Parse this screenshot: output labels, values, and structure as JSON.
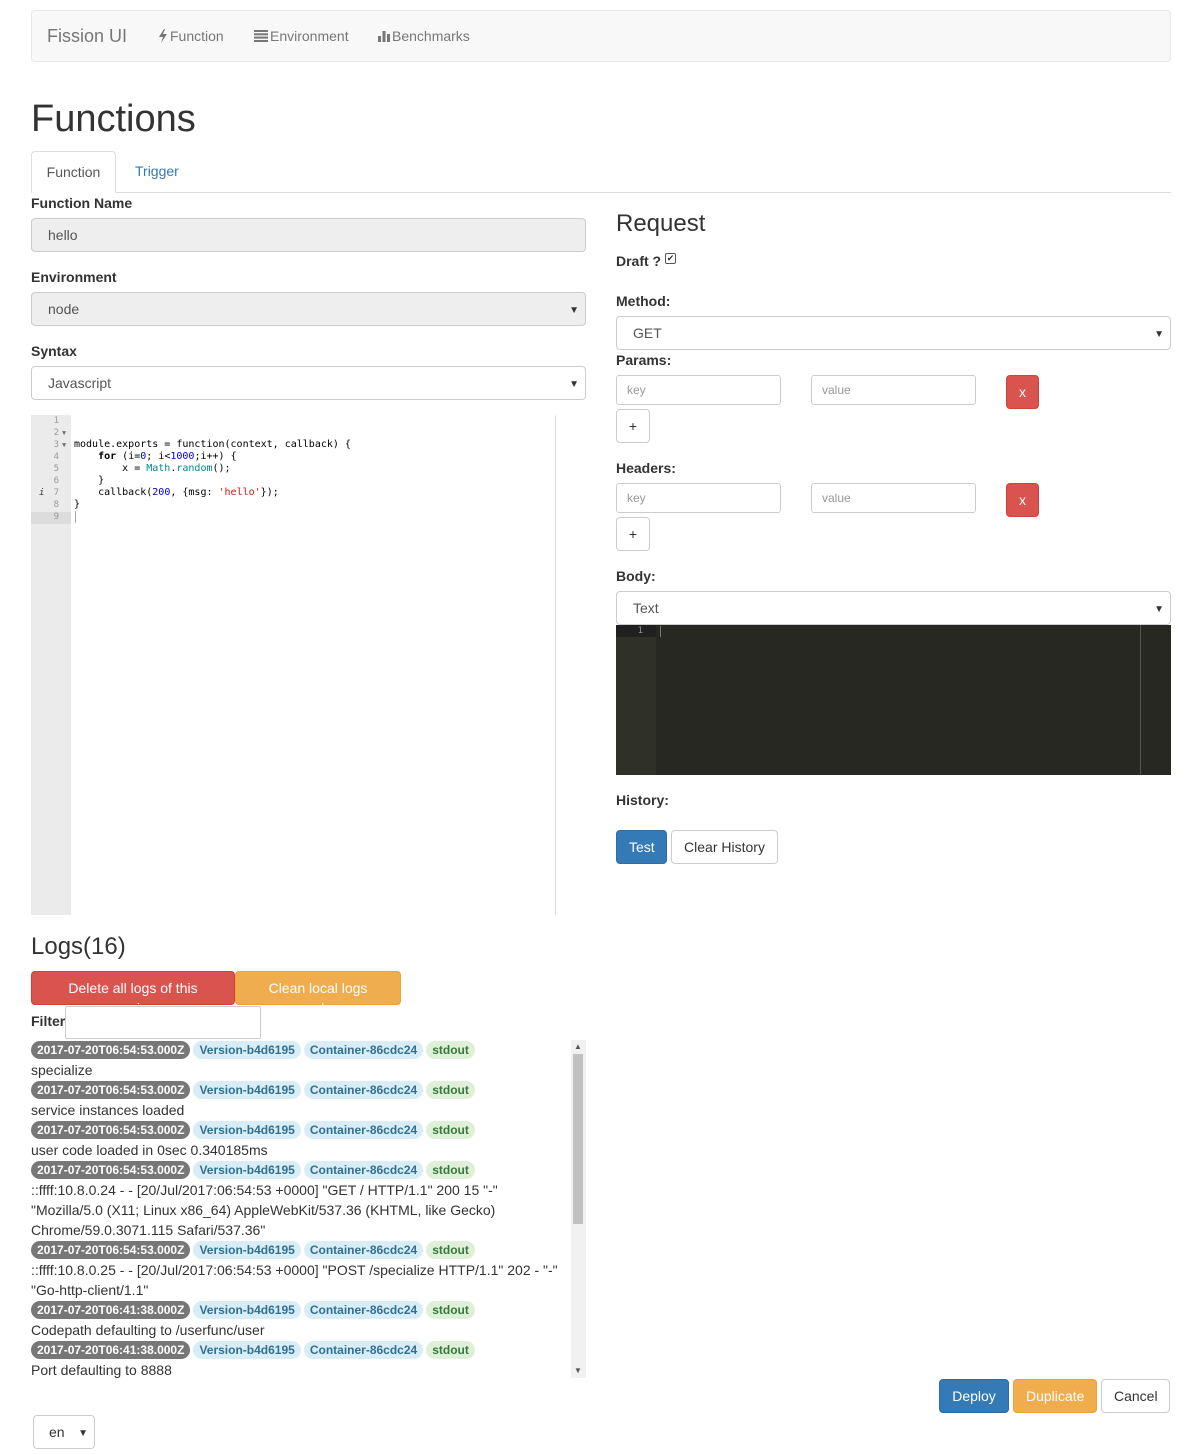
{
  "nav": {
    "brand": "Fission UI",
    "items": [
      {
        "label": "Function",
        "icon": "flash-icon"
      },
      {
        "label": "Environment",
        "icon": "list-icon"
      },
      {
        "label": "Benchmarks",
        "icon": "bar-chart-icon"
      }
    ]
  },
  "page_title": "Functions",
  "tabs": [
    {
      "label": "Function",
      "active": true
    },
    {
      "label": "Trigger",
      "active": false
    }
  ],
  "form": {
    "name_label": "Function Name",
    "name_value": "hello",
    "env_label": "Environment",
    "env_value": "node",
    "syntax_label": "Syntax",
    "syntax_value": "Javascript"
  },
  "code": {
    "line_numbers": [
      "1",
      "2",
      "3",
      "4",
      "5",
      "6",
      "7",
      "8",
      "9"
    ]
  },
  "request": {
    "title": "Request",
    "draft_label": "Draft ?",
    "draft_checked": true,
    "method_label": "Method:",
    "method_value": "GET",
    "params_label": "Params:",
    "headers_label": "Headers:",
    "key_placeholder": "key",
    "value_placeholder": "value",
    "remove_label": "x",
    "add_label": "+",
    "body_label": "Body:",
    "body_type": "Text",
    "body_line_number": "1",
    "history_label": "History:",
    "test_label": "Test",
    "clear_history_label": "Clear History"
  },
  "logs": {
    "title": "Logs(16)",
    "delete_label": "Delete all logs of this version",
    "clean_label": "Clean local logs cache",
    "filter_label": "Filter",
    "entries": [
      {
        "time": "2017-07-20T06:54:53.000Z",
        "version": "Version-b4d6195",
        "container": "Container-86cdc24",
        "stream": "stdout",
        "lines": [
          "specialize"
        ]
      },
      {
        "time": "2017-07-20T06:54:53.000Z",
        "version": "Version-b4d6195",
        "container": "Container-86cdc24",
        "stream": "stdout",
        "lines": [
          "service instances loaded"
        ]
      },
      {
        "time": "2017-07-20T06:54:53.000Z",
        "version": "Version-b4d6195",
        "container": "Container-86cdc24",
        "stream": "stdout",
        "lines": [
          "user code loaded in 0sec 0.340185ms"
        ]
      },
      {
        "time": "2017-07-20T06:54:53.000Z",
        "version": "Version-b4d6195",
        "container": "Container-86cdc24",
        "stream": "stdout",
        "lines": [
          "::ffff:10.8.0.24 - - [20/Jul/2017:06:54:53 +0000] \"GET / HTTP/1.1\" 200 15 \"-\"",
          "\"Mozilla/5.0 (X11; Linux x86_64) AppleWebKit/537.36 (KHTML, like Gecko)",
          "Chrome/59.0.3071.115 Safari/537.36\""
        ]
      },
      {
        "time": "2017-07-20T06:54:53.000Z",
        "version": "Version-b4d6195",
        "container": "Container-86cdc24",
        "stream": "stdout",
        "lines": [
          "::ffff:10.8.0.25 - - [20/Jul/2017:06:54:53 +0000] \"POST /specialize HTTP/1.1\" 202 - \"-\"",
          "\"Go-http-client/1.1\""
        ]
      },
      {
        "time": "2017-07-20T06:41:38.000Z",
        "version": "Version-b4d6195",
        "container": "Container-86cdc24",
        "stream": "stdout",
        "lines": [
          "Codepath defaulting to /userfunc/user"
        ]
      },
      {
        "time": "2017-07-20T06:41:38.000Z",
        "version": "Version-b4d6195",
        "container": "Container-86cdc24",
        "stream": "stdout",
        "lines": [
          "Port defaulting to 8888"
        ]
      }
    ]
  },
  "footer": {
    "deploy_label": "Deploy",
    "duplicate_label": "Duplicate",
    "cancel_label": "Cancel",
    "language": "en"
  }
}
